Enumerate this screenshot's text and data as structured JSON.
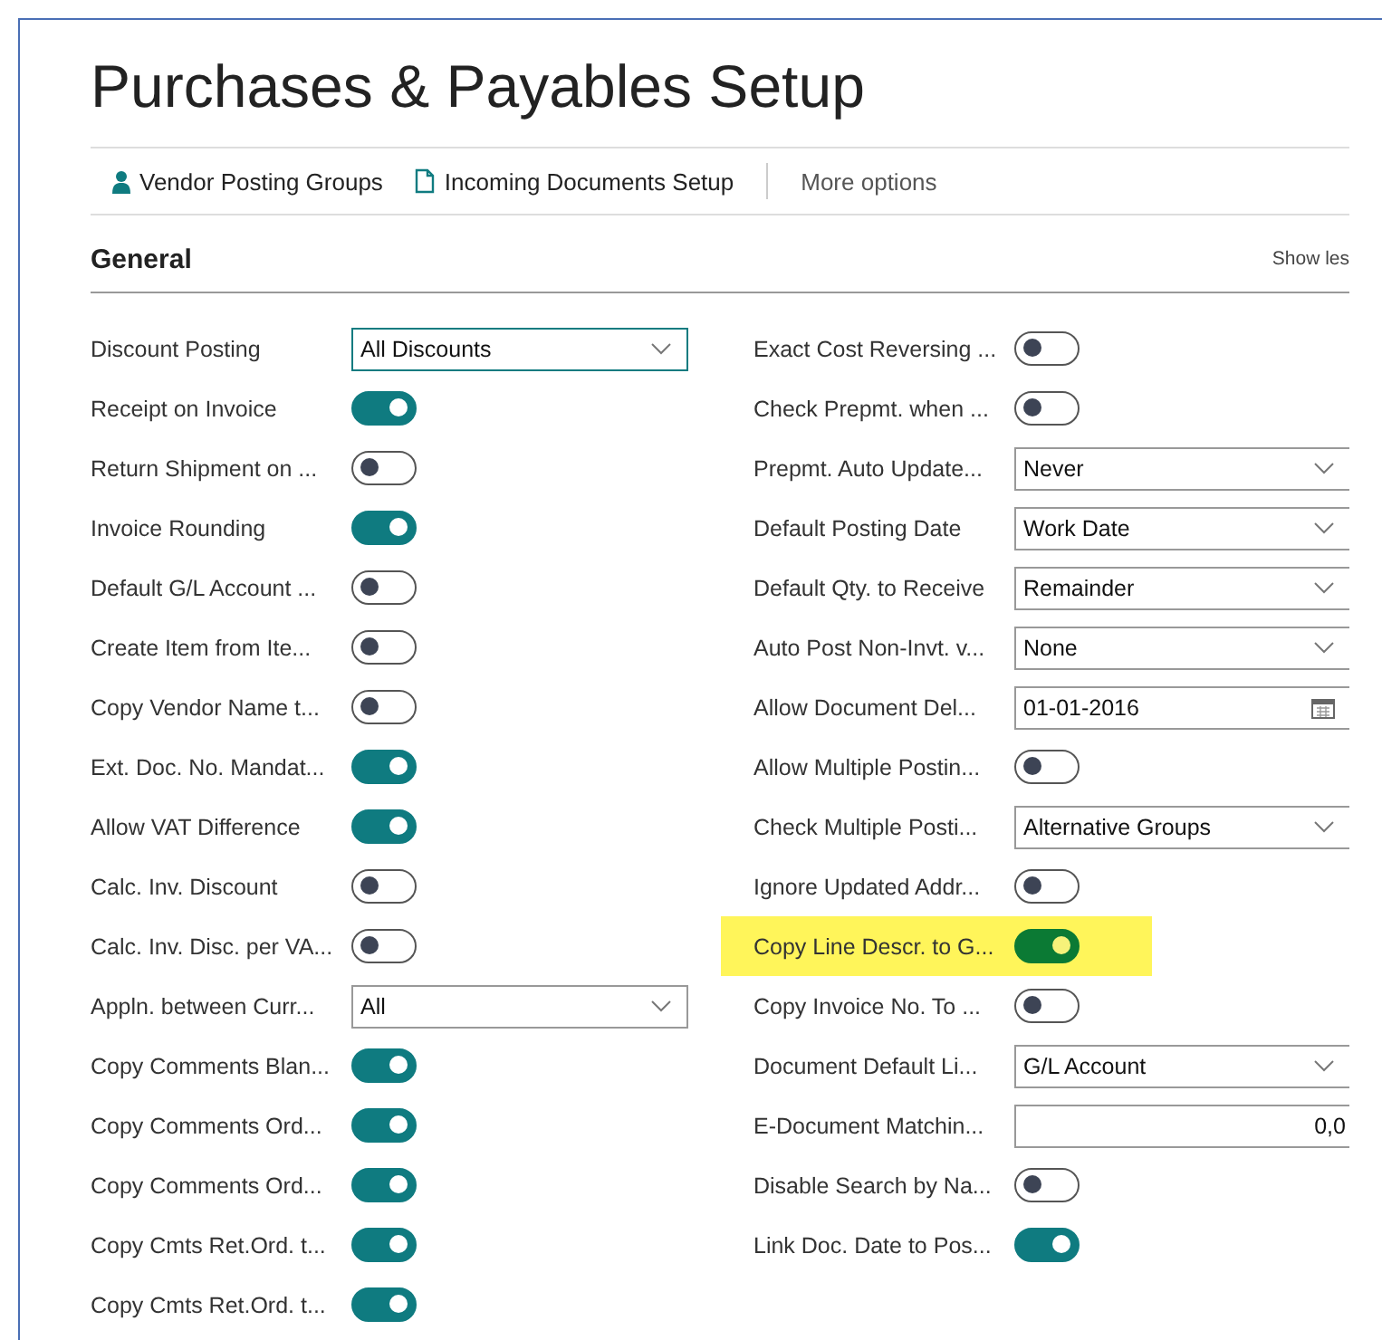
{
  "page": {
    "title": "Purchases & Payables Setup"
  },
  "actions": [
    {
      "label": "Vendor Posting Groups",
      "kind": "link"
    },
    {
      "label": "Incoming Documents Setup",
      "kind": "link"
    },
    {
      "label": "More options",
      "kind": "menu"
    }
  ],
  "section": {
    "title": "General",
    "toggle_label": "Show les"
  },
  "left_fields": [
    {
      "label": "Discount Posting",
      "kind": "select",
      "value": "All Discounts",
      "focused": true
    },
    {
      "label": "Receipt on Invoice",
      "kind": "toggle",
      "on": true
    },
    {
      "label": "Return Shipment on ...",
      "kind": "toggle",
      "on": false
    },
    {
      "label": "Invoice Rounding",
      "kind": "toggle",
      "on": true
    },
    {
      "label": "Default G/L Account ...",
      "kind": "toggle",
      "on": false
    },
    {
      "label": "Create Item from Ite...",
      "kind": "toggle",
      "on": false
    },
    {
      "label": "Copy Vendor Name t...",
      "kind": "toggle",
      "on": false
    },
    {
      "label": "Ext. Doc. No. Mandat...",
      "kind": "toggle",
      "on": true
    },
    {
      "label": "Allow VAT Difference",
      "kind": "toggle",
      "on": true
    },
    {
      "label": "Calc. Inv. Discount",
      "kind": "toggle",
      "on": false
    },
    {
      "label": "Calc. Inv. Disc. per VA...",
      "kind": "toggle",
      "on": false
    },
    {
      "label": "Appln. between Curr...",
      "kind": "select",
      "value": "All",
      "focused": false
    },
    {
      "label": "Copy Comments Blan...",
      "kind": "toggle",
      "on": true
    },
    {
      "label": "Copy Comments Ord...",
      "kind": "toggle",
      "on": true
    },
    {
      "label": "Copy Comments Ord...",
      "kind": "toggle",
      "on": true
    },
    {
      "label": "Copy Cmts Ret.Ord. t...",
      "kind": "toggle",
      "on": true
    },
    {
      "label": "Copy Cmts Ret.Ord. t...",
      "kind": "toggle",
      "on": true
    }
  ],
  "right_fields": [
    {
      "label": "Exact Cost Reversing ...",
      "kind": "toggle",
      "on": false
    },
    {
      "label": "Check Prepmt. when ...",
      "kind": "toggle",
      "on": false
    },
    {
      "label": "Prepmt. Auto Update...",
      "kind": "select",
      "value": "Never",
      "focused": false
    },
    {
      "label": "Default Posting Date",
      "kind": "select",
      "value": "Work Date",
      "focused": false
    },
    {
      "label": "Default Qty. to Receive",
      "kind": "select",
      "value": "Remainder",
      "focused": false
    },
    {
      "label": "Auto Post Non-Invt. v...",
      "kind": "select",
      "value": "None",
      "focused": false
    },
    {
      "label": "Allow Document Del...",
      "kind": "date",
      "value": "01-01-2016"
    },
    {
      "label": "Allow Multiple Postin...",
      "kind": "toggle",
      "on": false
    },
    {
      "label": "Check Multiple Posti...",
      "kind": "select",
      "value": "Alternative Groups",
      "focused": false
    },
    {
      "label": "Ignore Updated Addr...",
      "kind": "toggle",
      "on": false
    },
    {
      "label": "Copy Line Descr. to G...",
      "kind": "toggle",
      "on": true,
      "highlighted": true
    },
    {
      "label": "Copy Invoice No. To ...",
      "kind": "toggle",
      "on": false
    },
    {
      "label": "Document Default Li...",
      "kind": "select",
      "value": "G/L Account",
      "focused": false
    },
    {
      "label": "E-Document Matchin...",
      "kind": "number",
      "value": "0,0"
    },
    {
      "label": "Disable Search by Na...",
      "kind": "toggle",
      "on": false
    },
    {
      "label": "Link Doc. Date to Pos...",
      "kind": "toggle",
      "on": true
    }
  ]
}
